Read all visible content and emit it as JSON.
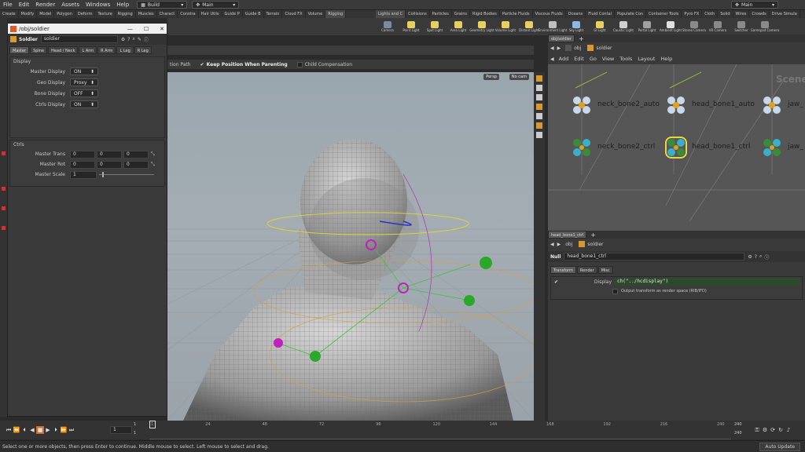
{
  "menu": [
    "File",
    "Edit",
    "Render",
    "Assets",
    "Windows",
    "Help"
  ],
  "desktop": {
    "build": "Build",
    "main": "Main",
    "main_right": "Main"
  },
  "shelf_tabs_left": [
    "Create",
    "Modify",
    "Model",
    "Polygon",
    "Deform",
    "Texture",
    "Rigging",
    "Muscles",
    "Charact",
    "Constra",
    "Hair Utils",
    "Guide P",
    "Guide B",
    "Terrain",
    "Cloud FX",
    "Volume",
    "Rigging"
  ],
  "shelf_tabs_right": [
    "Lights and C",
    "Collisions",
    "Particles",
    "Grains",
    "Rigid Bodies",
    "Particle Fluids",
    "Viscous Fluids",
    "Oceans",
    "Fluid Contai",
    "Populate Con",
    "Container Tools",
    "Pyro FX",
    "Cloth",
    "Solid",
    "Wires",
    "Crowds",
    "Drive Simula"
  ],
  "shelf_tools": [
    {
      "label": "Camera",
      "color": "#7a8ba0"
    },
    {
      "label": "Point Light",
      "color": "#e8d060"
    },
    {
      "label": "Spot Light",
      "color": "#e8d060"
    },
    {
      "label": "Area Light",
      "color": "#e8d060"
    },
    {
      "label": "Geometry Light",
      "color": "#e8d060"
    },
    {
      "label": "Volume Light",
      "color": "#e8d060"
    },
    {
      "label": "Distant Light",
      "color": "#e8d060"
    },
    {
      "label": "Environment Light",
      "color": "#c0c0c0"
    },
    {
      "label": "Sky Light",
      "color": "#8fb8e0"
    },
    {
      "label": "GI Light",
      "color": "#e8d060"
    },
    {
      "label": "Caustic Light",
      "color": "#d0d0d0"
    },
    {
      "label": "Portal Light",
      "color": "#a0a0a0"
    },
    {
      "label": "Ambient Light",
      "color": "#e0e0e0"
    },
    {
      "label": "Stereo Camera",
      "color": "#8a8a8a"
    },
    {
      "label": "VR Camera",
      "color": "#8a8a8a"
    },
    {
      "label": "Switcher",
      "color": "#8a8a8a"
    },
    {
      "label": "Gamepad Camera",
      "color": "#8a8a8a"
    }
  ],
  "float_window": {
    "title": "/obj/soldier",
    "node_type": "Soldier",
    "node_name": "soldier",
    "tabs": [
      "Master",
      "Spine",
      "Head / Neck",
      "L Arm",
      "R Arm",
      "L Leg",
      "R Leg"
    ],
    "display_section": "Display",
    "display_rows": [
      {
        "label": "Master Display",
        "value": "ON"
      },
      {
        "label": "Geo Display",
        "value": "Proxy"
      },
      {
        "label": "Bone Display",
        "value": "OFF"
      },
      {
        "label": "Ctrls Display",
        "value": "ON"
      }
    ],
    "ctrls_section": "Ctrls",
    "master_trans": {
      "label": "Master Trans",
      "values": [
        "0",
        "0",
        "0"
      ]
    },
    "master_rot": {
      "label": "Master Rot",
      "values": [
        "0",
        "0",
        "0"
      ]
    },
    "master_scale": {
      "label": "Master Scale",
      "value": "1"
    }
  },
  "viewport": {
    "opt1": "tion Path",
    "opt2": "Keep Position When Parenting",
    "opt3": "Child Compensation",
    "persp": "Persp",
    "cam": "No cam"
  },
  "network": {
    "tab": "obj/soldier",
    "path": "obj",
    "node": "soldier",
    "menu": [
      "Add",
      "Edit",
      "Go",
      "View",
      "Tools",
      "Layout",
      "Help"
    ],
    "watermark": "Scene",
    "nodes": [
      "neck_bone2_auto",
      "head_bone1_auto",
      "jaw_",
      "neck_bone2_ctrl",
      "head_bone1_ctrl",
      "jaw_"
    ]
  },
  "params": {
    "tab": "head_bone1_ctrl",
    "path": "obj",
    "node": "soldier",
    "type": "Null",
    "name": "head_bone1_ctrl",
    "tabs": [
      "Transform",
      "Render",
      "Misc"
    ],
    "display_label": "Display",
    "display_expr": "ch(\"../hcdisplay\")",
    "output_label": "Output transform as render space (RIB/IFD)"
  },
  "timeline": {
    "frame": "1",
    "start": "1",
    "start2": "1",
    "ticks": [
      "1",
      "24",
      "48",
      "72",
      "96",
      "120",
      "144",
      "168",
      "192",
      "216",
      "240"
    ],
    "end": "240",
    "end2": "240"
  },
  "status": {
    "message": "Select one or more objects, then press Enter to continue. Middle mouse to select. Left mouse to select and drag.",
    "auto_update": "Auto Update"
  }
}
